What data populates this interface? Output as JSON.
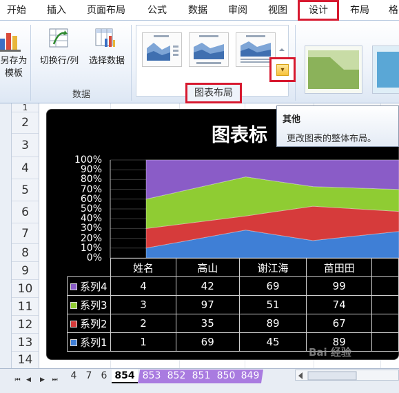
{
  "ribbon_tabs": [
    {
      "label": "开始"
    },
    {
      "label": "插入"
    },
    {
      "label": "页面布局"
    },
    {
      "label": "公式"
    },
    {
      "label": "数据"
    },
    {
      "label": "审阅"
    },
    {
      "label": "视图"
    },
    {
      "label": "设计",
      "selected": true
    },
    {
      "label": "布局"
    },
    {
      "label": "格"
    }
  ],
  "ribbon": {
    "save_template_line1": "另存为",
    "save_template_line2": "模板",
    "switch_row_col": "切换行/列",
    "select_data": "选择数据",
    "data_group_label": "数据",
    "chart_layout_group_label": "图表布局",
    "more_button_glyph": "▾"
  },
  "tooltip": {
    "title": "其他",
    "body": "更改图表的整体布局。"
  },
  "row_numbers": [
    "1",
    "2",
    "3",
    "4",
    "5",
    "6",
    "7",
    "8",
    "9",
    "10",
    "11",
    "12",
    "13",
    "14"
  ],
  "chart_data": {
    "type": "area",
    "stacked": "percent",
    "title": "图表标",
    "categories": [
      "姓名",
      "高山",
      "谢江海",
      "苗田田"
    ],
    "ylim": [
      0,
      100
    ],
    "y_ticks": [
      "0%",
      "10%",
      "20%",
      "30%",
      "40%",
      "50%",
      "60%",
      "70%",
      "80%",
      "90%",
      "100%"
    ],
    "series": [
      {
        "name": "系列1",
        "values": [
          1,
          69,
          45,
          89
        ],
        "color": "#3f7fd6"
      },
      {
        "name": "系列2",
        "values": [
          2,
          35,
          89,
          67
        ],
        "color": "#d63b3b"
      },
      {
        "name": "系列3",
        "values": [
          3,
          97,
          51,
          74
        ],
        "color": "#8fcc33"
      },
      {
        "name": "系列4",
        "values": [
          4,
          42,
          69,
          99
        ],
        "color": "#8a5cc7"
      }
    ],
    "table_rows_order": [
      "系列4",
      "系列3",
      "系列2",
      "系列1"
    ]
  },
  "sheet_tabs": [
    {
      "label": "4",
      "style": "plain"
    },
    {
      "label": "7",
      "style": "plain"
    },
    {
      "label": "6",
      "style": "plain"
    },
    {
      "label": "854",
      "style": "active"
    },
    {
      "label": "853",
      "style": "purple"
    },
    {
      "label": "852",
      "style": "purple"
    },
    {
      "label": "851",
      "style": "purple"
    },
    {
      "label": "850",
      "style": "purple"
    },
    {
      "label": "849",
      "style": "purple"
    }
  ],
  "watermark": "Bai 经验"
}
